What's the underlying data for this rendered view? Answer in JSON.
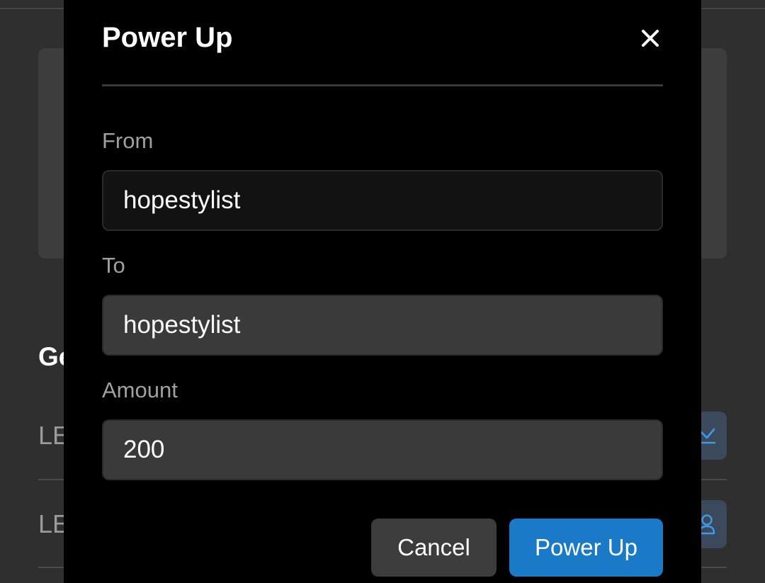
{
  "background": {
    "heading": "Ge",
    "rows": [
      {
        "label": "LE",
        "action_icon": "download-icon"
      },
      {
        "label": "LE",
        "action_icon": "user-icon"
      }
    ]
  },
  "modal": {
    "title": "Power Up",
    "close_icon": "close-icon",
    "fields": {
      "from": {
        "label": "From",
        "value": "hopestylist"
      },
      "to": {
        "label": "To",
        "value": "hopestylist"
      },
      "amount": {
        "label": "Amount",
        "value": "200"
      }
    },
    "cancel_label": "Cancel",
    "submit_label": "Power Up"
  },
  "colors": {
    "accent": "#1a7ac8",
    "modal_bg": "#000000",
    "page_bg": "#2f2f2f"
  }
}
